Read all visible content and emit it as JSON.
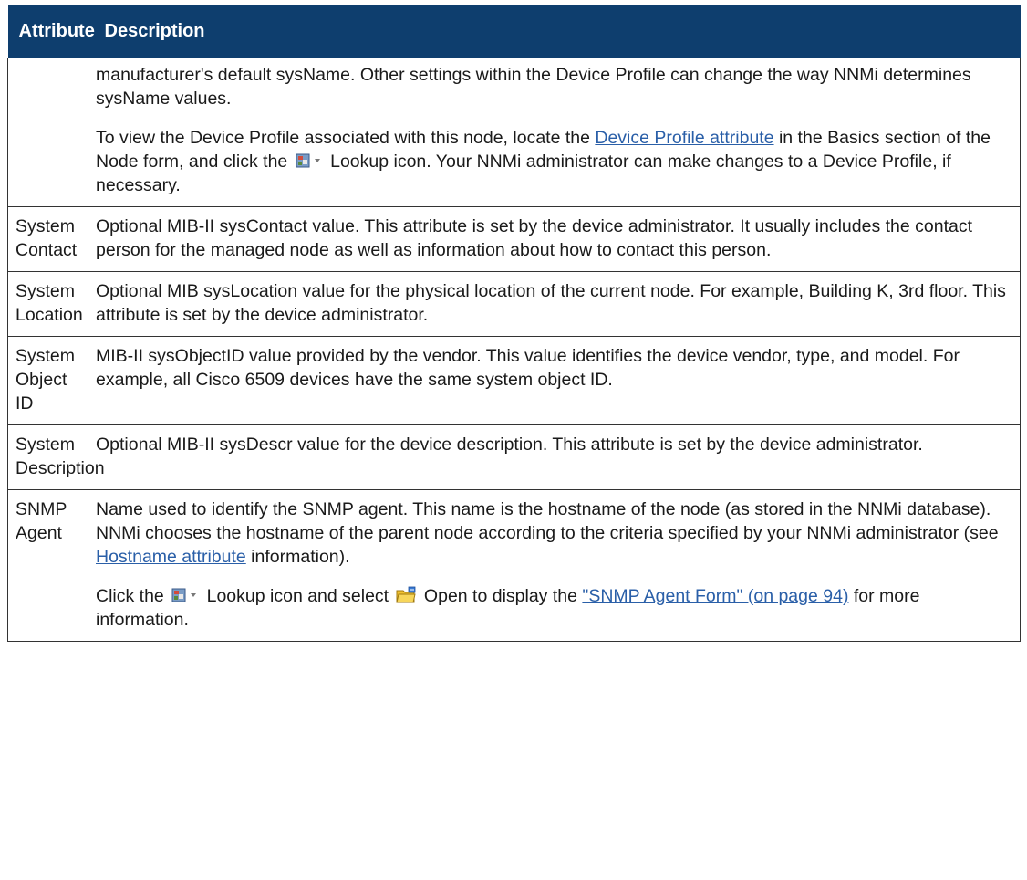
{
  "table": {
    "header": {
      "col1": "Attribute",
      "col2": "Description"
    },
    "row0": {
      "attribute": "",
      "p1": "manufacturer's default sysName. Other settings within the Device Profile can change the way NNMi determines sysName values.",
      "p2_a": "To view the Device Profile associated with this node, locate the ",
      "p2_link": "Device Profile attribute",
      "p2_b": " in the Basics section of the Node form, and click the ",
      "p2_c": " Lookup icon. Your NNMi administrator can make changes to a Device Profile, if necessary."
    },
    "rows": [
      {
        "attribute": "System Contact",
        "description": "Optional MIB-II sysContact value. This attribute is set by the device administrator. It usually includes the contact person for the managed node as well as information about how to contact this person."
      },
      {
        "attribute": "System Location",
        "description": "Optional MIB sysLocation value for the physical location of the current node. For example, Building K, 3rd floor. This attribute is set by the device administrator."
      },
      {
        "attribute": "System Object ID",
        "description": "MIB-II sysObjectID value provided by the vendor. This value identifies the device vendor, type, and model. For example, all Cisco 6509 devices have the same system object ID."
      },
      {
        "attribute": "System Description",
        "description": "Optional MIB-II sysDescr value for the device description. This attribute is set by the device administrator."
      }
    ],
    "snmp": {
      "attribute": "SNMP Agent",
      "p1_a": "Name used to identify the SNMP agent. This name is the hostname of the node (as stored in the NNMi database). NNMi chooses the hostname of the parent node according to the criteria specified by your NNMi administrator (see ",
      "p1_link": "Hostname attribute",
      "p1_b": " information).",
      "p2_a": "Click the ",
      "p2_b": " Lookup icon and select ",
      "p2_c": " Open to display the ",
      "p2_link": "\"SNMP Agent Form\" (on page 94)",
      "p2_d": " for more information."
    }
  },
  "icons": {
    "lookup": "lookup-icon",
    "open": "open-folder-icon"
  },
  "colors": {
    "header_bg": "#0e3e6e",
    "link": "#2a5fa8"
  }
}
